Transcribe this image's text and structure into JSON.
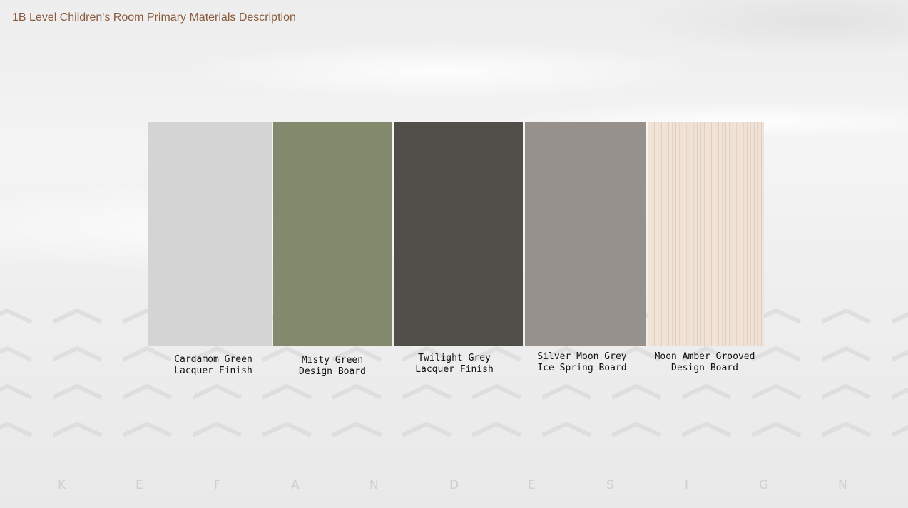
{
  "page": {
    "title": "1B Level Children's Room Primary Materials Description",
    "title_color": "#8a5a3c"
  },
  "materials": [
    {
      "line1": "Cardamom Green",
      "line2": "Lacquer Finish",
      "color": "#d4d4d4"
    },
    {
      "line1": "Misty Green",
      "line2": "Design Board",
      "color": "#83896c"
    },
    {
      "line1": "Twilight Grey",
      "line2": "Lacquer Finish",
      "color": "#504e49"
    },
    {
      "line1": "Silver Moon Grey",
      "line2": "Ice Spring Board",
      "color": "#96918c"
    },
    {
      "line1": "Moon Amber Grooved",
      "line2": "Design Board",
      "color": "#efe1d5"
    }
  ],
  "brand": {
    "letters": [
      "K",
      "E",
      "F",
      "A",
      "N",
      "D",
      "E",
      "S",
      "I",
      "G",
      "N"
    ],
    "color": "#cfcfcf"
  }
}
